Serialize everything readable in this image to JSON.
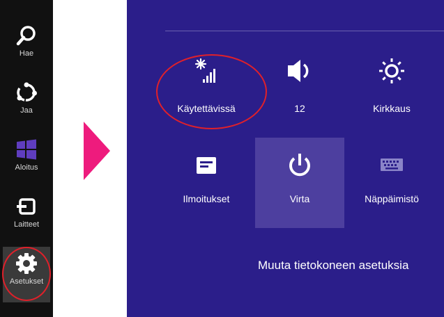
{
  "charms": [
    {
      "name": "search",
      "label": "Hae"
    },
    {
      "name": "share",
      "label": "Jaa"
    },
    {
      "name": "start",
      "label": "Aloitus"
    },
    {
      "name": "devices",
      "label": "Laitteet"
    },
    {
      "name": "settings",
      "label": "Asetukset"
    }
  ],
  "settings_panel": {
    "tiles": [
      {
        "name": "network",
        "label": "Käytettävissä",
        "icon": "network-signal-icon"
      },
      {
        "name": "volume",
        "label": "12",
        "icon": "speaker-icon"
      },
      {
        "name": "brightness",
        "label": "Kirkkaus",
        "icon": "sun-icon"
      },
      {
        "name": "notifications",
        "label": "Ilmoitukset",
        "icon": "notification-icon"
      },
      {
        "name": "power",
        "label": "Virta",
        "icon": "power-icon"
      },
      {
        "name": "keyboard",
        "label": "Näppäimistö",
        "icon": "keyboard-icon"
      }
    ],
    "pc_settings_link": "Muuta tietokoneen asetuksia"
  },
  "colors": {
    "charms_bg": "#111111",
    "panel_bg": "#2b1e8a",
    "highlight": "#4d3f9f",
    "arrow": "#ee1b7d",
    "annotation_ring": "#e0202a"
  }
}
